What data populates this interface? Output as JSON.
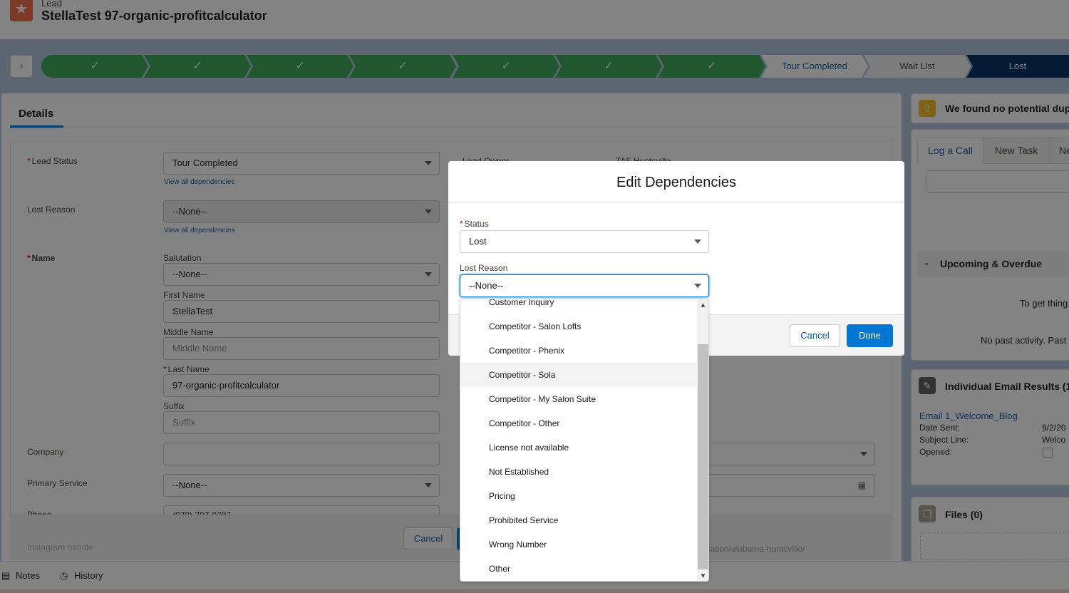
{
  "header": {
    "object_type": "Lead",
    "record_title": "StellaTest 97-organic-profitcalculator"
  },
  "path": {
    "completed_mark": "✓",
    "stages": [
      {
        "label": "Tour Completed",
        "state": "current"
      },
      {
        "label": "Wait List",
        "state": "incomplete"
      },
      {
        "label": "Lost",
        "state": "selected"
      }
    ]
  },
  "details": {
    "tab_label": "Details",
    "lead_status_label": "Lead Status",
    "lead_status_value": "Tour Completed",
    "view_all_dependencies": "View all dependencies",
    "lost_reason_label": "Lost Reason",
    "lost_reason_value": "--None--",
    "lead_owner_label": "Lead Owner",
    "lead_owner_value": "TAF Huntsville",
    "name_label": "Name",
    "salutation_label": "Salutation",
    "salutation_value": "--None--",
    "first_name_label": "First Name",
    "first_name_value": "StellaTest",
    "middle_name_label": "Middle Name",
    "middle_name_placeholder": "Middle Name",
    "last_name_label": "Last Name",
    "last_name_value": "97-organic-profitcalculator",
    "suffix_label": "Suffix",
    "suffix_placeholder": "Suffix",
    "company_label": "Company",
    "company_value": "",
    "primary_service_label": "Primary Service",
    "primary_service_value": "--None--",
    "phone_label": "Phone",
    "phone_value": "(978) 707-9797",
    "instagram_label": "Instagram handle",
    "website_partial": "ocation/alabama-huntsville/",
    "cancel_label": "Cancel"
  },
  "sidebar": {
    "duplicates_text": "We found no potential dup",
    "activity_tabs": [
      "Log a Call",
      "New Task",
      "Ne"
    ],
    "upcoming_label": "Upcoming & Overdue",
    "upcoming_text": "To get thing",
    "past_activity_text": "No past activity. Past",
    "email_results_title": "Individual Email Results (1",
    "email_link": "Email 1_Welcome_Blog",
    "date_sent_label": "Date Sent:",
    "date_sent_value": "9/2/20",
    "subject_line_label": "Subject Line:",
    "subject_line_value": "Welco",
    "opened_label": "Opened:",
    "files_title": "Files (0)"
  },
  "utility_bar": {
    "notes_label": "Notes",
    "history_label": "History"
  },
  "modal": {
    "title": "Edit Dependencies",
    "status_label": "Status",
    "status_value": "Lost",
    "lost_reason_label": "Lost Reason",
    "lost_reason_value": "--None--",
    "cancel_label": "Cancel",
    "done_label": "Done",
    "options": [
      "Customer Inquiry",
      "Competitor - Salon Lofts",
      "Competitor - Phenix",
      "Competitor - Sola",
      "Competitor - My Salon Suite",
      "Competitor - Other",
      "License not available",
      "Not Established",
      "Pricing",
      "Prohibited Service",
      "Wrong Number",
      "Other"
    ],
    "hovered_option": "Competitor - Sola"
  },
  "colors": {
    "brand_blue": "#0176d3",
    "path_complete_green": "#3ba755",
    "path_selected_navy": "#032d60",
    "lead_icon_orange": "#f26a47"
  }
}
